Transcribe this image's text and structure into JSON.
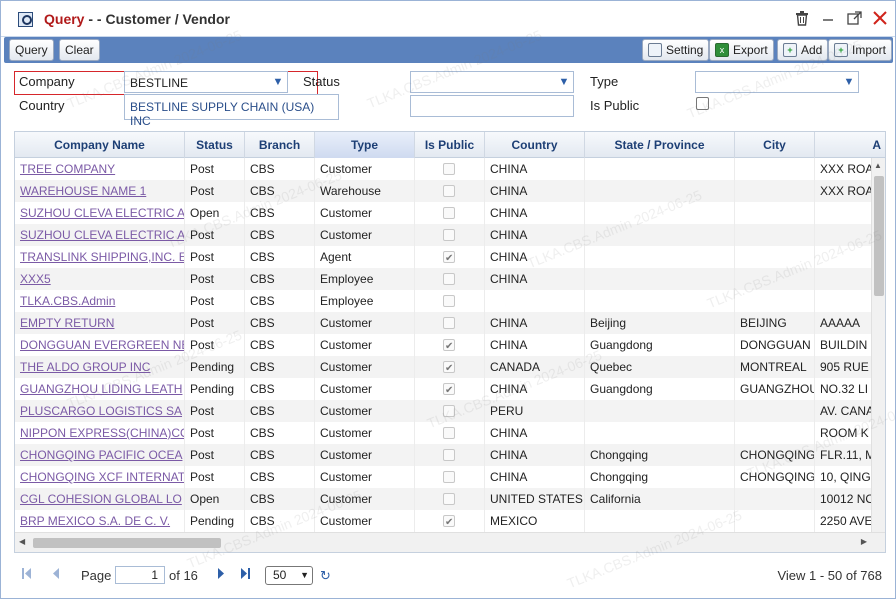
{
  "window": {
    "title_prefix": "Query",
    "title_sep": " - - ",
    "title_main": "Customer / Vendor"
  },
  "toolbar": {
    "query_label": "Query",
    "clear_label": "Clear",
    "setting_label": "Setting",
    "export_label": "Export",
    "add_label": "Add",
    "import_label": "Import"
  },
  "filters": {
    "company_label": "Company",
    "company_value": "BESTLINE",
    "company_suggestion": "BESTLINE SUPPLY CHAIN (USA) INC",
    "status_label": "Status",
    "status_value": "",
    "type_label": "Type",
    "type_value": "",
    "country_label": "Country",
    "country_value": "",
    "is_public_label": "Is Public"
  },
  "grid": {
    "columns": [
      "Company Name",
      "Status",
      "Branch",
      "Type",
      "Is Public",
      "Country",
      "State / Province",
      "City",
      "A"
    ],
    "rows": [
      {
        "name": "TREE COMPANY",
        "status": "Post",
        "branch": "CBS",
        "type": "Customer",
        "public": false,
        "country": "CHINA",
        "state": "",
        "city": "",
        "addr": "XXX ROA"
      },
      {
        "name": "WAREHOUSE NAME 1",
        "status": "Post",
        "branch": "CBS",
        "type": "Warehouse",
        "public": false,
        "country": "CHINA",
        "state": "",
        "city": "",
        "addr": "XXX ROA"
      },
      {
        "name": "SUZHOU CLEVA ELECTRIC A",
        "status": "Open",
        "branch": "CBS",
        "type": "Customer",
        "public": false,
        "country": "CHINA",
        "state": "",
        "city": "",
        "addr": ""
      },
      {
        "name": "SUZHOU CLEVA ELECTRIC A",
        "status": "Post",
        "branch": "CBS",
        "type": "Customer",
        "public": false,
        "country": "CHINA",
        "state": "",
        "city": "",
        "addr": ""
      },
      {
        "name": "TRANSLINK SHIPPING,INC. E",
        "status": "Post",
        "branch": "CBS",
        "type": "Agent",
        "public": true,
        "country": "CHINA",
        "state": "",
        "city": "",
        "addr": ""
      },
      {
        "name": "XXX5",
        "status": "Post",
        "branch": "CBS",
        "type": "Employee",
        "public": false,
        "country": "CHINA",
        "state": "",
        "city": "",
        "addr": ""
      },
      {
        "name": "TLKA.CBS.Admin",
        "status": "Post",
        "branch": "CBS",
        "type": "Employee",
        "public": false,
        "country": "",
        "state": "",
        "city": "",
        "addr": ""
      },
      {
        "name": "EMPTY RETURN",
        "status": "Post",
        "branch": "CBS",
        "type": "Customer",
        "public": false,
        "country": "CHINA",
        "state": "Beijing",
        "city": "BEIJING",
        "addr": "AAAAA"
      },
      {
        "name": "DONGGUAN EVERGREEN NE",
        "status": "Post",
        "branch": "CBS",
        "type": "Customer",
        "public": true,
        "country": "CHINA",
        "state": "Guangdong",
        "city": "DONGGUAN",
        "addr": "BUILDIN"
      },
      {
        "name": "THE ALDO GROUP INC",
        "status": "Pending",
        "branch": "CBS",
        "type": "Customer",
        "public": true,
        "country": "CANADA",
        "state": "Quebec",
        "city": "MONTREAL",
        "addr": "905 RUE"
      },
      {
        "name": "GUANGZHOU LIDING LEATH",
        "status": "Pending",
        "branch": "CBS",
        "type": "Customer",
        "public": true,
        "country": "CHINA",
        "state": "Guangdong",
        "city": "GUANGZHOU",
        "addr": "NO.32 LI"
      },
      {
        "name": "PLUSCARGO LOGISTICS SA",
        "status": "Post",
        "branch": "CBS",
        "type": "Customer",
        "public": false,
        "country": "PERU",
        "state": "",
        "city": "",
        "addr": "AV. CANA"
      },
      {
        "name": "NIPPON EXPRESS(CHINA)CO",
        "status": "Post",
        "branch": "CBS",
        "type": "Customer",
        "public": false,
        "country": "CHINA",
        "state": "",
        "city": "",
        "addr": "ROOM K"
      },
      {
        "name": "CHONGQING PACIFIC OCEA",
        "status": "Post",
        "branch": "CBS",
        "type": "Customer",
        "public": false,
        "country": "CHINA",
        "state": "Chongqing",
        "city": "CHONGQING",
        "addr": "FLR.11, M"
      },
      {
        "name": "CHONGQING XCF INTERNAT",
        "status": "Post",
        "branch": "CBS",
        "type": "Customer",
        "public": false,
        "country": "CHINA",
        "state": "Chongqing",
        "city": "CHONGQING",
        "addr": "10, QING"
      },
      {
        "name": "CGL COHESION GLOBAL LO",
        "status": "Open",
        "branch": "CBS",
        "type": "Customer",
        "public": false,
        "country": "UNITED STATES",
        "state": "California",
        "city": "",
        "addr": "10012 NO"
      },
      {
        "name": "BRP MEXICO S.A. DE C. V.",
        "status": "Pending",
        "branch": "CBS",
        "type": "Customer",
        "public": true,
        "country": "MEXICO",
        "state": "",
        "city": "",
        "addr": "2250 AVE"
      }
    ]
  },
  "pager": {
    "page_label": "Page",
    "page_value": "1",
    "of_label": "of 16",
    "page_size": "50",
    "view_text": "View 1 - 50 of 768"
  },
  "watermark_text": "TLKA.CBS.Admin 2024-06-25",
  "icons": [
    "search-icon",
    "trash-icon",
    "minimize-icon",
    "maximize-icon",
    "close-icon",
    "setting-icon",
    "export-icon",
    "add-icon",
    "import-icon",
    "chevron-down-icon",
    "first-page-icon",
    "prev-page-icon",
    "next-page-icon",
    "last-page-icon",
    "refresh-icon"
  ]
}
